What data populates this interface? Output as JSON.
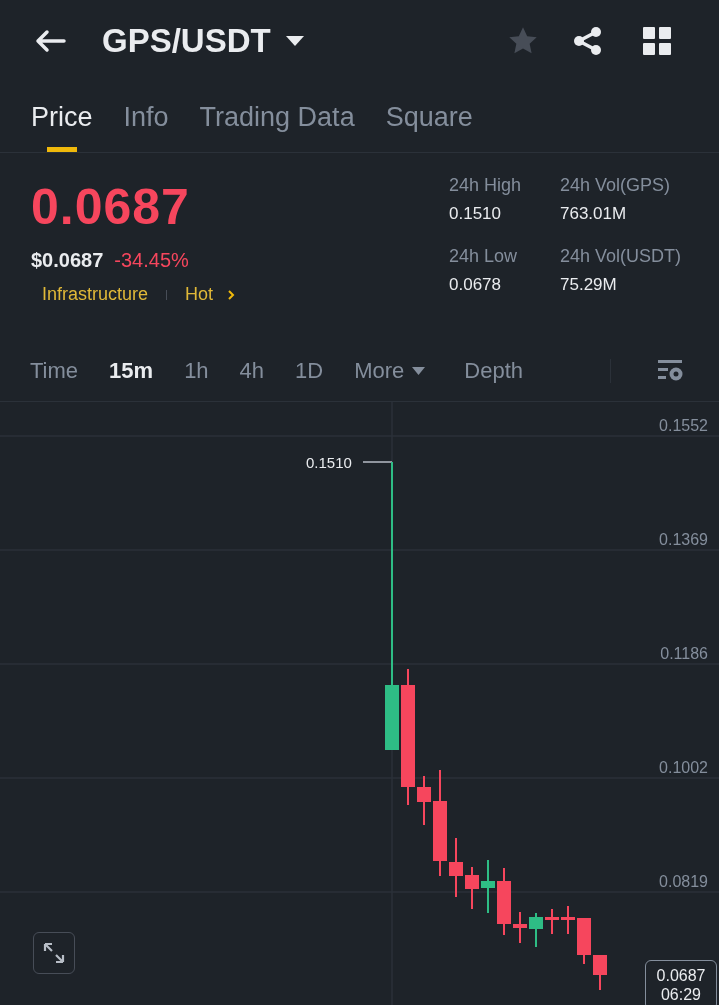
{
  "header": {
    "title": "GPS/USDT",
    "favorite": false
  },
  "tabs": [
    {
      "label": "Price",
      "selected": true
    },
    {
      "label": "Info",
      "selected": false
    },
    {
      "label": "Trading Data",
      "selected": false
    },
    {
      "label": "Square",
      "selected": false
    }
  ],
  "price": {
    "last": "0.0687",
    "usd": "$0.0687",
    "change": "-34.45%",
    "tags": [
      "Infrastructure",
      "Hot"
    ]
  },
  "stats": [
    {
      "label": "24h High",
      "value": "0.1510"
    },
    {
      "label": "24h Vol(GPS)",
      "value": "763.01M"
    },
    {
      "label": "24h Low",
      "value": "0.0678"
    },
    {
      "label": "24h Vol(USDT)",
      "value": "75.29M"
    }
  ],
  "intervals": [
    {
      "label": "Time",
      "selected": false,
      "kind": "plain"
    },
    {
      "label": "15m",
      "selected": true,
      "kind": "plain"
    },
    {
      "label": "1h",
      "selected": false,
      "kind": "plain"
    },
    {
      "label": "4h",
      "selected": false,
      "kind": "plain"
    },
    {
      "label": "1D",
      "selected": false,
      "kind": "plain"
    },
    {
      "label": "More",
      "selected": false,
      "kind": "menu"
    },
    {
      "label": "Depth",
      "selected": false,
      "kind": "view"
    }
  ],
  "chart": {
    "price_axis": [
      "0.1552",
      "0.1369",
      "0.1186",
      "0.1002",
      "0.0819"
    ],
    "high_label": "0.1510",
    "last_label": "0.0687",
    "countdown": "06:29"
  }
}
